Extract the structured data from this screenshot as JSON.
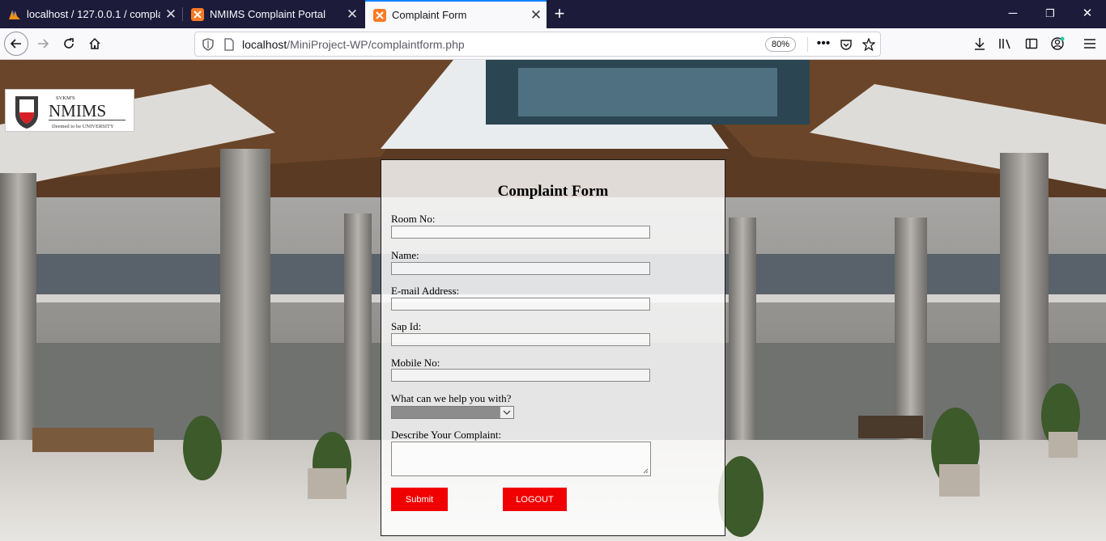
{
  "browser": {
    "tabs": [
      {
        "title": "localhost / 127.0.0.1 / complaint",
        "active": false
      },
      {
        "title": "NMIMS Complaint Portal",
        "active": false
      },
      {
        "title": "Complaint Form",
        "active": true
      }
    ],
    "url_host": "localhost",
    "url_path": "/MiniProject-WP/complaintform.php",
    "zoom": "80%"
  },
  "logo": {
    "top_text": "SVKM'S",
    "name": "NMIMS",
    "tagline": "Deemed to be UNIVERSITY"
  },
  "form": {
    "title": "Complaint Form",
    "fields": {
      "room_no": {
        "label": "Room No:",
        "value": ""
      },
      "name": {
        "label": "Name:",
        "value": ""
      },
      "email": {
        "label": "E-mail Address:",
        "value": ""
      },
      "sap_id": {
        "label": "Sap Id:",
        "value": ""
      },
      "mobile_no": {
        "label": "Mobile No:",
        "value": ""
      },
      "help_type": {
        "label": "What can we help you with?",
        "selected": ""
      },
      "complaint": {
        "label": "Describe Your Complaint:",
        "value": ""
      }
    },
    "submit_label": "Submit",
    "logout_label": "LOGOUT"
  },
  "colors": {
    "button": "#f00000",
    "tab_accent": "#0a84ff"
  }
}
